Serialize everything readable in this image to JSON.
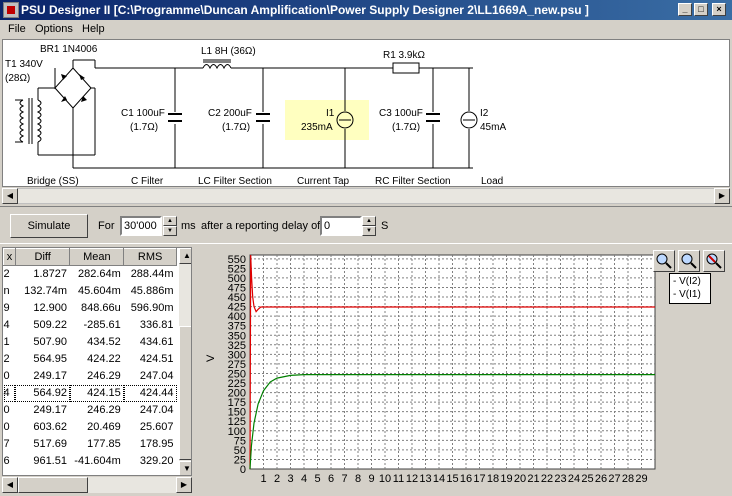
{
  "window": {
    "title": "PSU Designer II  [C:\\Programme\\Duncan Amplification\\Power Supply Designer 2\\LL1669A_new.psu ]"
  },
  "menu": [
    "File",
    "Options",
    "Help"
  ],
  "schematic": {
    "transformer": {
      "name": "T1 340V",
      "res": "(28Ω)"
    },
    "bridge": {
      "name": "BR1 1N4006",
      "section": "Bridge (SS)"
    },
    "c1": {
      "name": "C1 100uF",
      "res": "(1.7Ω)",
      "section": "C Filter"
    },
    "l1": {
      "name": "L1 8H (36Ω)"
    },
    "c2": {
      "name": "C2 200uF",
      "res": "(1.7Ω)",
      "section": "LC Filter Section"
    },
    "i1": {
      "name": "I1",
      "value": "235mA",
      "section": "Current Tap"
    },
    "r1": {
      "name": "R1 3.9kΩ"
    },
    "c3": {
      "name": "C3 100uF",
      "res": "(1.7Ω)",
      "section": "RC Filter Section"
    },
    "i2": {
      "name": "I2",
      "value": "45mA",
      "section": "Load"
    }
  },
  "toolbar": {
    "simulate_label": "Simulate",
    "for_label": "For",
    "duration": "30'000",
    "ms_label": "ms",
    "delay_label": "after a reporting delay of",
    "delay": "0",
    "s_label": "S"
  },
  "table": {
    "headers": [
      "x",
      "Diff",
      "Mean",
      "RMS"
    ],
    "rows": [
      [
        "2",
        "1.8727",
        "282.64m",
        "288.44m"
      ],
      [
        "n",
        "132.74m",
        "45.604m",
        "45.886m"
      ],
      [
        "9",
        "12.900",
        "848.66u",
        "596.90m"
      ],
      [
        "4",
        "509.22",
        "-285.61",
        "336.81"
      ],
      [
        "1",
        "507.90",
        "434.52",
        "434.61"
      ],
      [
        "2",
        "564.95",
        "424.22",
        "424.51"
      ],
      [
        "0",
        "249.17",
        "246.29",
        "247.04"
      ],
      [
        "4",
        "564.92",
        "424.15",
        "424.44"
      ],
      [
        "0",
        "249.17",
        "246.29",
        "247.04"
      ],
      [
        "0",
        "603.62",
        "20.469",
        "25.607"
      ],
      [
        "7",
        "517.69",
        "177.85",
        "178.95"
      ],
      [
        "6",
        "961.51",
        "-41.604m",
        "329.20"
      ]
    ],
    "selected_row": 7
  },
  "colors": {
    "series1": "#e00000",
    "series2": "#008000",
    "plot_bg": "#ffffff",
    "grid": "#808080"
  },
  "chart_data": {
    "type": "line",
    "ylabel": "V",
    "xlabel": "",
    "xlim": [
      0,
      30
    ],
    "ylim": [
      0,
      560
    ],
    "xticks": [
      "1",
      "2",
      "3",
      "4",
      "5",
      "6",
      "7",
      "8",
      "9",
      "10",
      "11",
      "12",
      "13",
      "14",
      "15",
      "16",
      "17",
      "18",
      "19",
      "20",
      "21",
      "22",
      "23",
      "24",
      "25",
      "26",
      "27",
      "28",
      "29"
    ],
    "yticks": [
      "0",
      "25",
      "50",
      "75",
      "100",
      "125",
      "150",
      "175",
      "200",
      "225",
      "250",
      "275",
      "300",
      "325",
      "350",
      "375",
      "400",
      "425",
      "450",
      "475",
      "500",
      "525",
      "550"
    ],
    "legend": [
      "- V(I2)",
      "- V(I1)"
    ],
    "legend_position": "top-right",
    "series": [
      {
        "name": "V(I2)",
        "color": "#e00000",
        "x": [
          0,
          0.05,
          0.12,
          0.2,
          0.3,
          0.45,
          0.6,
          0.8,
          1.0,
          2,
          30
        ],
        "y": [
          0,
          560,
          500,
          450,
          425,
          412,
          418,
          424,
          424,
          424,
          424
        ]
      },
      {
        "name": "V(I1)",
        "color": "#008000",
        "x": [
          0,
          0.1,
          0.3,
          0.6,
          1.0,
          1.5,
          2,
          3,
          4,
          5,
          30
        ],
        "y": [
          0,
          60,
          120,
          170,
          205,
          228,
          238,
          245,
          247,
          247,
          247
        ]
      }
    ]
  }
}
